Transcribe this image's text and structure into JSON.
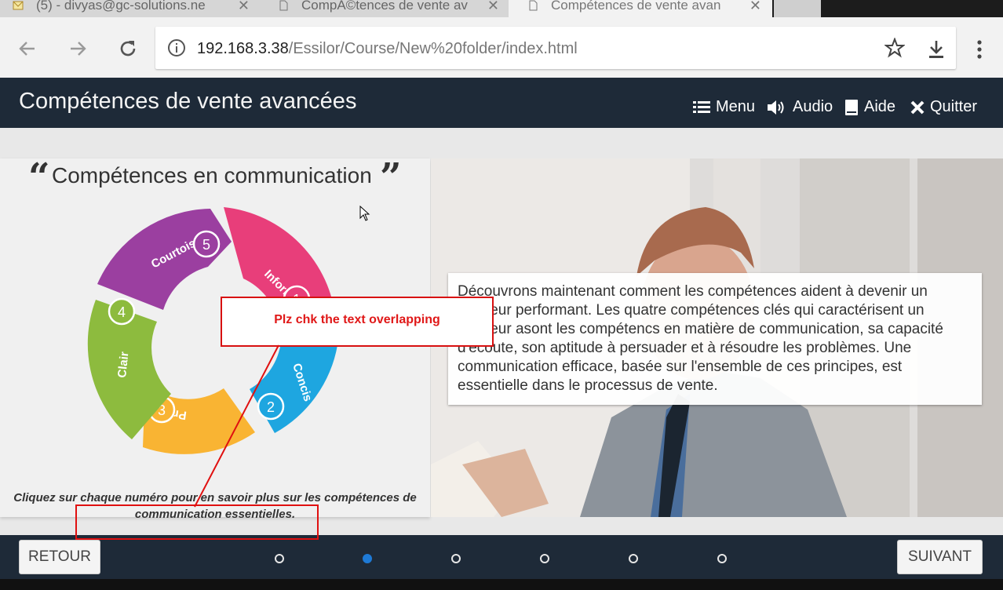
{
  "browser": {
    "tabs": [
      {
        "label": "(5) - divyas@gc-solutions.ne",
        "icon": "mail-icon",
        "active": false
      },
      {
        "label": "CompÃ©tences de vente av",
        "icon": "page-icon",
        "active": false
      },
      {
        "label": "Compétences de vente avan",
        "icon": "page-icon",
        "active": true
      }
    ],
    "url_host": "192.168.3.38",
    "url_path": "/Essilor/Course/New%20folder/index.html"
  },
  "app": {
    "title": "Compétences de vente avancées",
    "menu_label": "Menu",
    "audio_label": "Audio",
    "help_label": "Aide",
    "quit_label": "Quitter"
  },
  "slide": {
    "title": "Compétences en communication",
    "segments": [
      {
        "number": "1",
        "label": "Informé",
        "color": "#e83e7a"
      },
      {
        "number": "2",
        "label": "Concis",
        "color": "#1ea6e0"
      },
      {
        "number": "3",
        "label": "Prévenant",
        "color": "#f9b433"
      },
      {
        "number": "4",
        "label": "Clair",
        "color": "#8dbb3e"
      },
      {
        "number": "5",
        "label": "Courtois",
        "color": "#9b3fa0"
      }
    ],
    "instruction": "Cliquez sur chaque numéro pour en savoir plus sur les compétences de communication essentielles.",
    "body_text": "Découvrons maintenant comment les compétences aident à devenir un vendeur performant. Les quatre compétences clés qui caractérisent un vendeur asont les compétencs en matière de communication, sa capacité d'écoute, son aptitude à persuader et à résoudre les problèmes. Une communication efficace, basée sur l'ensemble de ces principes, est essentielle dans le processus de vente."
  },
  "footer": {
    "back_label": "RETOUR",
    "next_label": "SUIVANT",
    "pages": 6,
    "current_page": 2
  },
  "annotation": {
    "note": "Plz chk the text overlapping",
    "color": "#e01010"
  }
}
